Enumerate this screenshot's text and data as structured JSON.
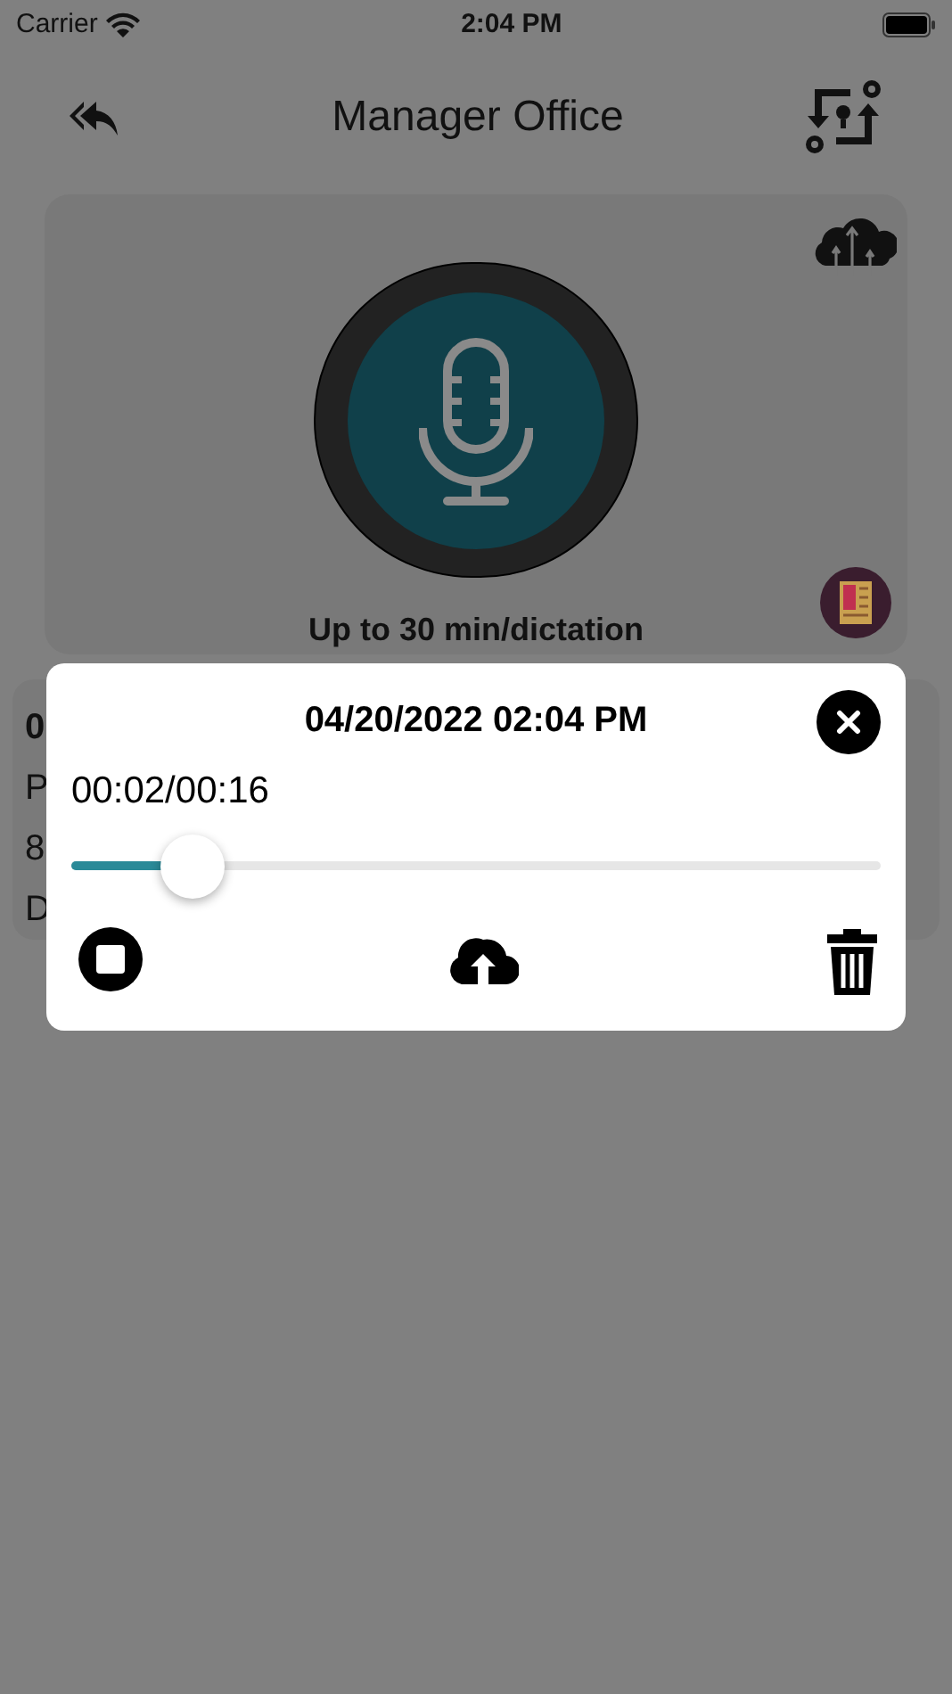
{
  "status_bar": {
    "carrier": "Carrier",
    "time": "2:04 PM"
  },
  "header": {
    "title": "Manager Office"
  },
  "recorder": {
    "caption": "Up to 30 min/dictation"
  },
  "background_card": {
    "lines": [
      {
        "text": "0",
        "bold": true
      },
      {
        "text": "P",
        "bold": false
      },
      {
        "text": "8",
        "bold": false
      },
      {
        "text": "D",
        "bold": false
      }
    ]
  },
  "player": {
    "title": "04/20/2022 02:04 PM",
    "time": "00:02/00:16",
    "level": 0.15
  }
}
